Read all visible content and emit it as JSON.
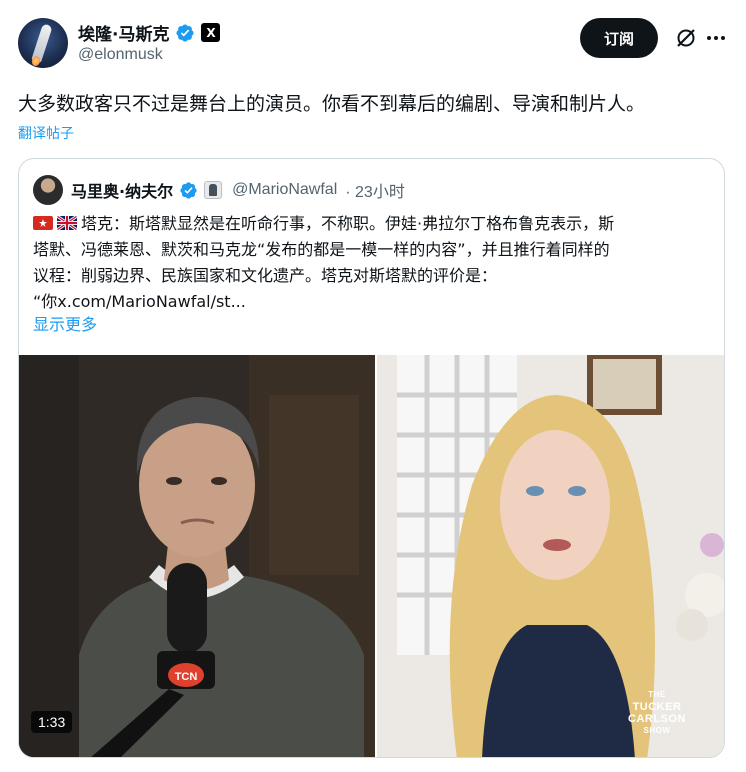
{
  "post": {
    "author": {
      "display_name": "埃隆·马斯克",
      "handle": "@elonmusk",
      "x_badge": "X"
    },
    "subscribe_label": "订阅",
    "text": "大多数政客只不过是舞台上的演员。你看不到幕后的编剧、导演和制片人。",
    "translate_label": "翻译帖子"
  },
  "quoted_post": {
    "author": {
      "display_name": "马里奥·纳夫尔",
      "handle": "@MarioNawfal",
      "time": "· 23小时"
    },
    "text_lines": [
      "塔克：斯塔默显然是在听命行事，不称职。伊娃·弗拉尔丁格布鲁克表示，斯",
      "塔默、冯德莱恩、默茨和马克龙“发布的都是一模一样的内容”，并且推行着同样的",
      "议程：削弱边界、民族国家和文化遗产。塔克对斯塔默的评价是：",
      "“你x.com/MarioNawfal/st..."
    ],
    "show_more_label": "显示更多",
    "flags": [
      "red-flag-icon",
      "uk-flag-icon"
    ],
    "video": {
      "duration": "1:33",
      "watermark_line1": "THE",
      "watermark_line2": "TUCKER",
      "watermark_line3": "CARLSON",
      "watermark_line4": "SHOW",
      "mic_label": "TCN"
    }
  },
  "colors": {
    "accent": "#1d9bf0",
    "text": "#0f1419",
    "muted": "#536471",
    "border": "#cfd9de"
  }
}
